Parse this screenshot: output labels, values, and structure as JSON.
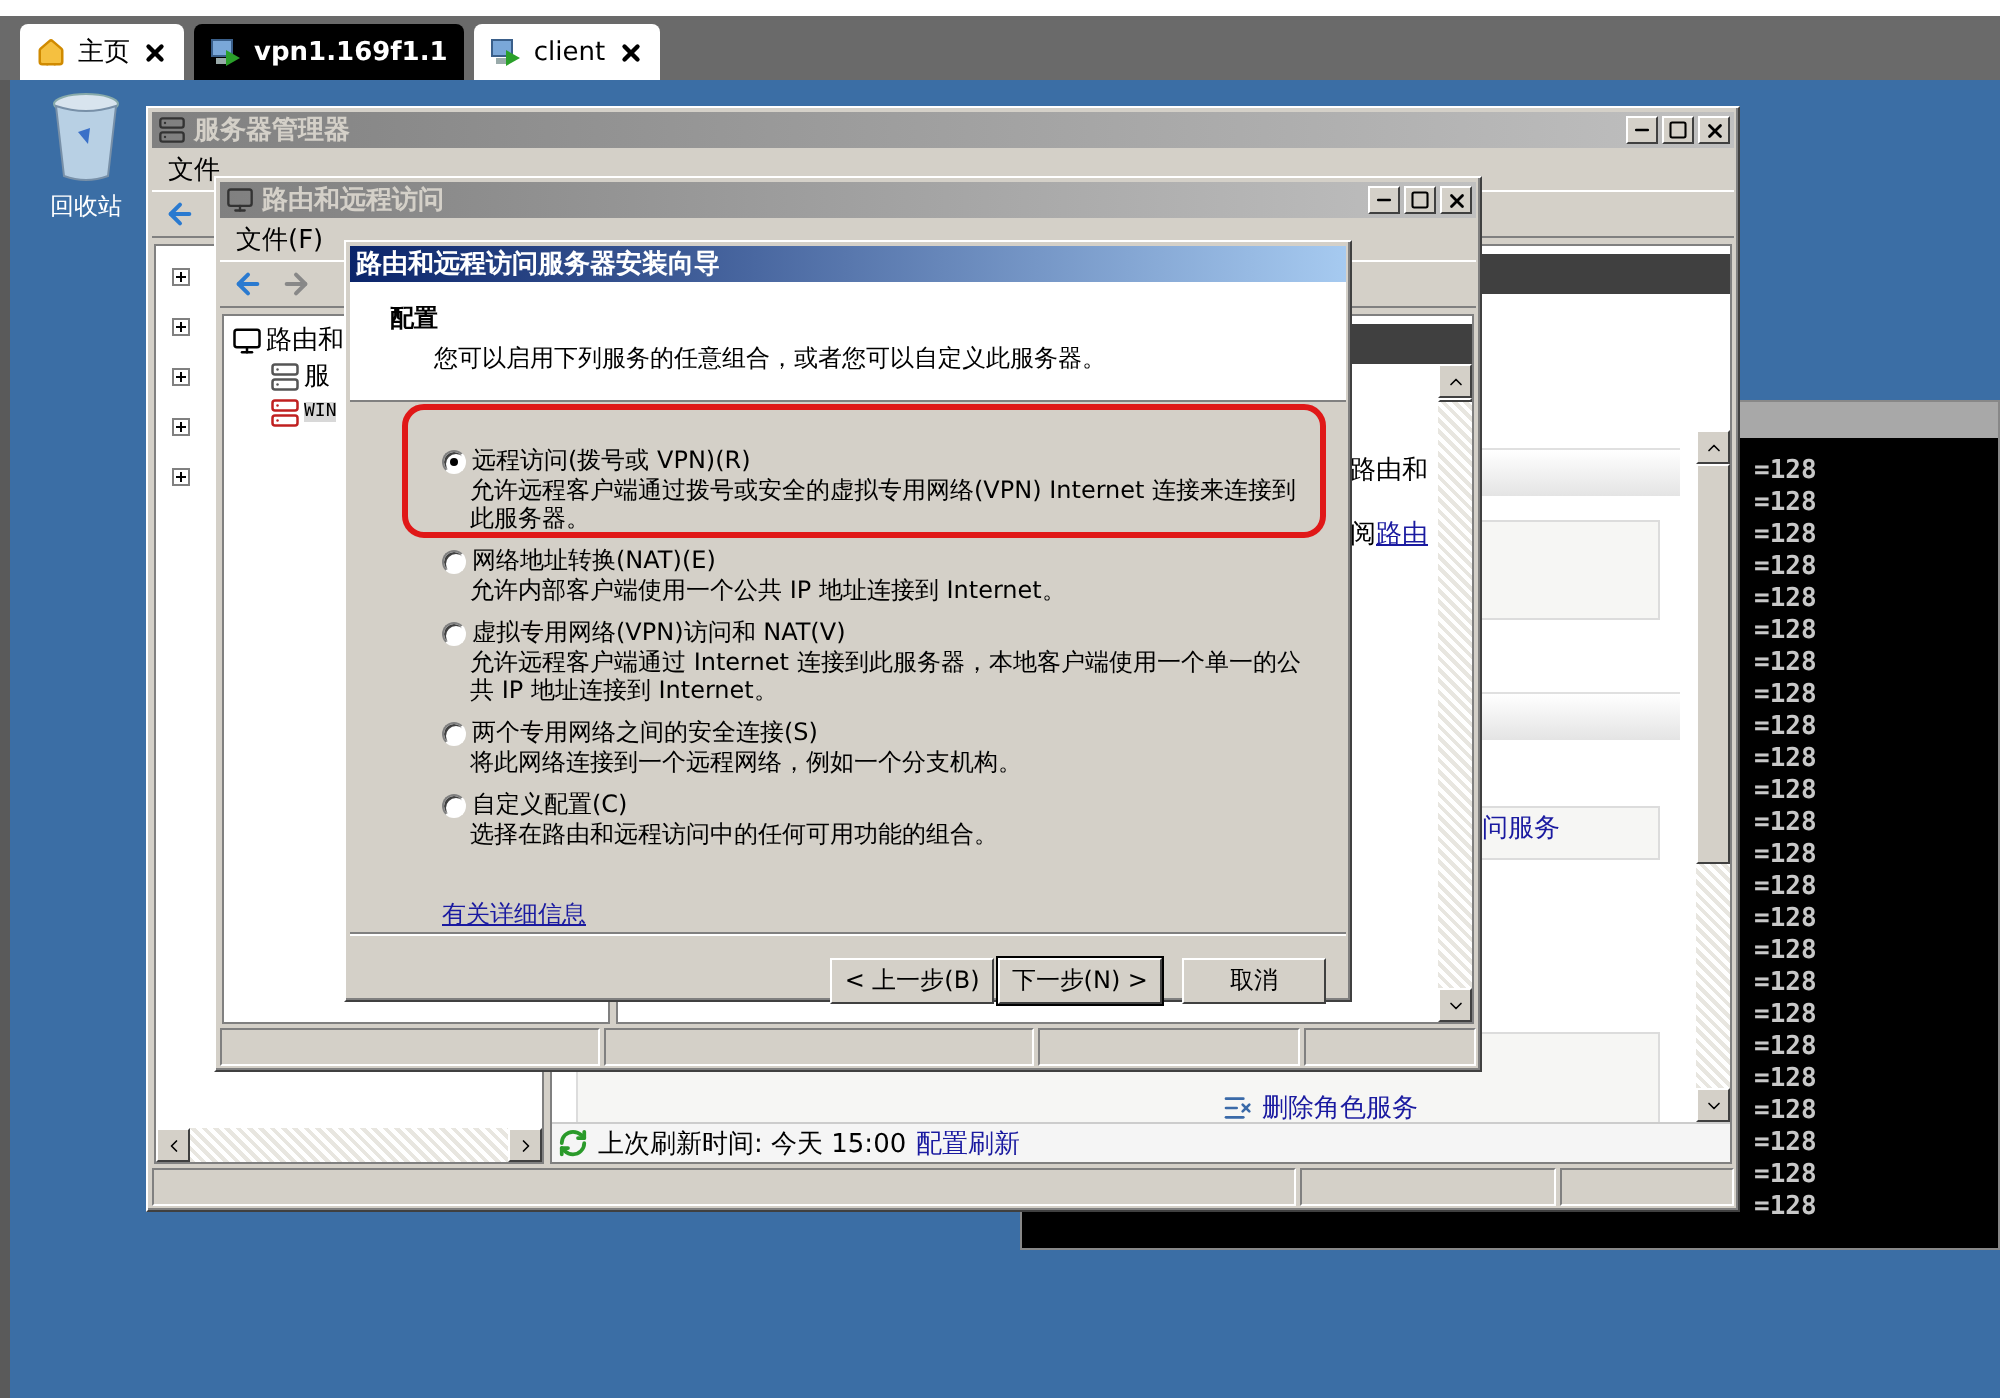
{
  "browser_tabs": [
    {
      "label": "主页",
      "kind": "home",
      "selected": false,
      "closable": true
    },
    {
      "label": "vpn1.169f1.1",
      "kind": "remote",
      "selected": true,
      "closable": false
    },
    {
      "label": "client",
      "kind": "remote",
      "selected": false,
      "closable": true
    }
  ],
  "desktop_icons": [
    {
      "label": "回收站"
    }
  ],
  "terminal": {
    "lines": [
      "=128",
      "=128",
      "=128",
      "=128",
      "=128",
      "=128",
      "=128",
      "=128",
      "=128",
      "=128",
      "=128",
      "=128",
      "=128",
      "=128",
      "=128",
      "=128",
      "=128",
      "=128",
      "=128",
      "=128",
      "=128",
      "=128",
      "=128",
      "=128"
    ]
  },
  "server_manager": {
    "title": "服务器管理器",
    "menu": [
      "文件"
    ],
    "role_panel_text": "问服务",
    "role_action": "删除角色服务",
    "refresh_text": "上次刷新时间: 今天 15:00",
    "refresh_link": "配置刷新"
  },
  "routing_window": {
    "title": "路由和远程访问",
    "menu": [
      "文件(F)"
    ],
    "tree": [
      {
        "label": "路由和",
        "selected": false,
        "children": [
          {
            "label": "服",
            "selected": false
          },
          {
            "label": "WIN",
            "selected": true
          }
        ]
      }
    ],
    "pane_text": "路由和",
    "pane_prefix": "阅",
    "pane_link": "路由"
  },
  "wizard": {
    "title": "路由和远程访问服务器安装向导",
    "heading": "配置",
    "subtitle": "您可以启用下列服务的任意组合，或者您可以自定义此服务器。",
    "options": [
      {
        "label": "远程访问(拨号或 VPN)(R)",
        "description": "允许远程客户端通过拨号或安全的虚拟专用网络(VPN) Internet 连接来连接到此服务器。",
        "selected": true,
        "highlighted": true
      },
      {
        "label": "网络地址转换(NAT)(E)",
        "description": "允许内部客户端使用一个公共 IP 地址连接到 Internet。",
        "selected": false,
        "highlighted": false
      },
      {
        "label": "虚拟专用网络(VPN)访问和 NAT(V)",
        "description": "允许远程客户端通过 Internet 连接到此服务器，本地客户端使用一个单一的公共 IP 地址连接到 Internet。",
        "selected": false,
        "highlighted": false
      },
      {
        "label": "两个专用网络之间的安全连接(S)",
        "description": "将此网络连接到一个远程网络，例如一个分支机构。",
        "selected": false,
        "highlighted": false
      },
      {
        "label": "自定义配置(C)",
        "description": "选择在路由和远程访问中的任何可用功能的组合。",
        "selected": false,
        "highlighted": false
      }
    ],
    "link": "有关详细信息",
    "buttons": [
      {
        "label": "< 上一步(B)",
        "default": false
      },
      {
        "label": "下一步(N) >",
        "default": true
      },
      {
        "label": "取消",
        "default": false
      }
    ]
  }
}
